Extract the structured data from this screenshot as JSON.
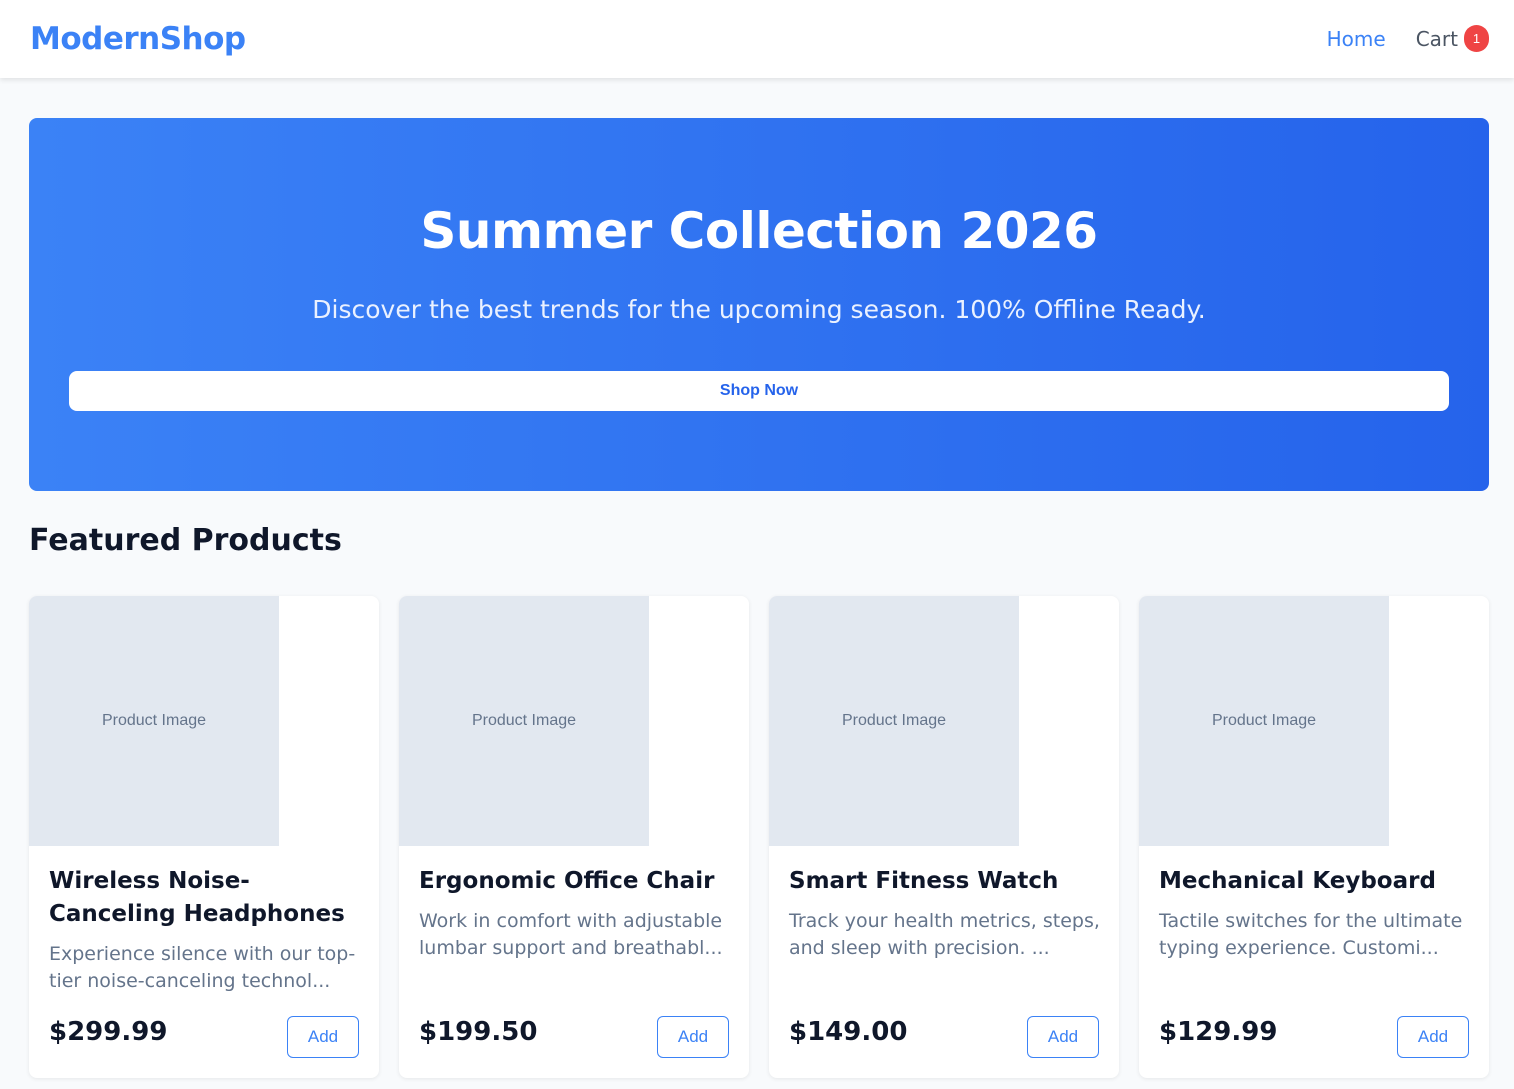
{
  "brand": {
    "name": "ModernShop",
    "color": "#3b82f6"
  },
  "nav": {
    "home_label": "Home",
    "cart_label": "Cart",
    "cart_count": "1"
  },
  "hero": {
    "title": "Summer Collection 2026",
    "subtitle": "Discover the best trends for the upcoming season. 100% Offline Ready.",
    "cta_label": "Shop Now",
    "gradient": [
      "#3b82f6",
      "#2563eb"
    ]
  },
  "featured": {
    "title": "Featured Products",
    "products": [
      {
        "image_placeholder": "Product Image",
        "name": "Wireless Noise-Canceling Headphones",
        "description": "Experience silence with our top-tier noise-canceling technol...",
        "price": "$299.99",
        "add_label": "Add"
      },
      {
        "image_placeholder": "Product Image",
        "name": "Ergonomic Office Chair",
        "description": "Work in comfort with adjustable lumbar support and breathabl...",
        "price": "$199.50",
        "add_label": "Add"
      },
      {
        "image_placeholder": "Product Image",
        "name": "Smart Fitness Watch",
        "description": "Track your health metrics, steps, and sleep with precision. ...",
        "price": "$149.00",
        "add_label": "Add"
      },
      {
        "image_placeholder": "Product Image",
        "name": "Mechanical Keyboard",
        "description": "Tactile switches for the ultimate typing experience. Customi...",
        "price": "$129.99",
        "add_label": "Add"
      }
    ]
  },
  "colors": {
    "accent": "#3b82f6",
    "badge": "#ef4444",
    "background": "#f8fafc"
  }
}
